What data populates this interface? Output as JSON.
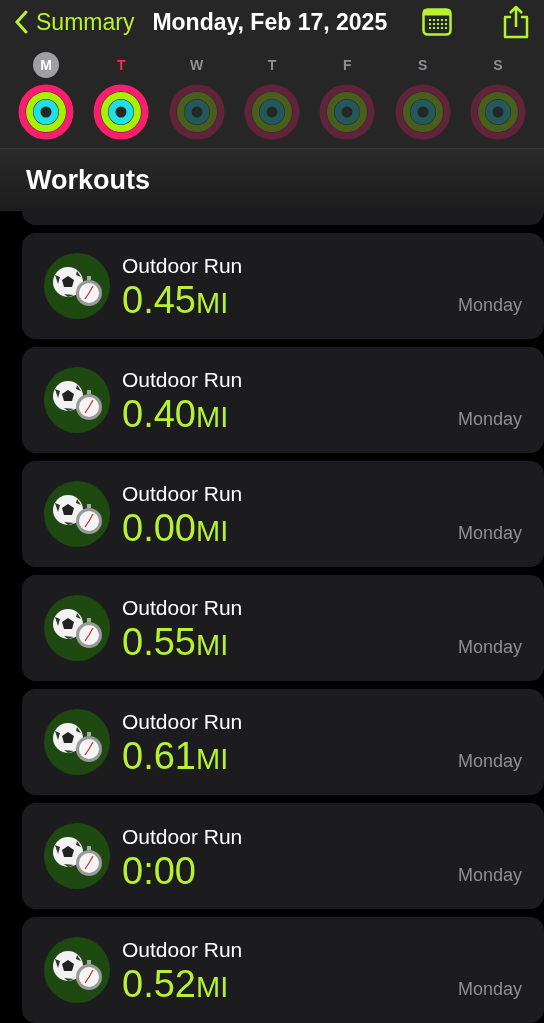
{
  "nav": {
    "back": "Summary",
    "title": "Monday, Feb 17, 2025"
  },
  "days": [
    {
      "label": "M",
      "selected": true,
      "today": false,
      "active": true
    },
    {
      "label": "T",
      "selected": false,
      "today": true,
      "active": true
    },
    {
      "label": "W",
      "selected": false,
      "today": false,
      "active": false
    },
    {
      "label": "T",
      "selected": false,
      "today": false,
      "active": false
    },
    {
      "label": "F",
      "selected": false,
      "today": false,
      "active": false
    },
    {
      "label": "S",
      "selected": false,
      "today": false,
      "active": false
    },
    {
      "label": "S",
      "selected": false,
      "today": false,
      "active": false
    }
  ],
  "section": "Workouts",
  "workouts": [
    {
      "name": "Outdoor Run",
      "value": "0.45",
      "unit": "MI",
      "day": "Monday"
    },
    {
      "name": "Outdoor Run",
      "value": "0.40",
      "unit": "MI",
      "day": "Monday"
    },
    {
      "name": "Outdoor Run",
      "value": "0.00",
      "unit": "MI",
      "day": "Monday"
    },
    {
      "name": "Outdoor Run",
      "value": "0.55",
      "unit": "MI",
      "day": "Monday"
    },
    {
      "name": "Outdoor Run",
      "value": "0.61",
      "unit": "MI",
      "day": "Monday"
    },
    {
      "name": "Outdoor Run",
      "value": "0:00",
      "day": "Monday"
    },
    {
      "name": "Outdoor Run",
      "value": "0.52",
      "unit": "MI",
      "day": "Monday"
    }
  ]
}
